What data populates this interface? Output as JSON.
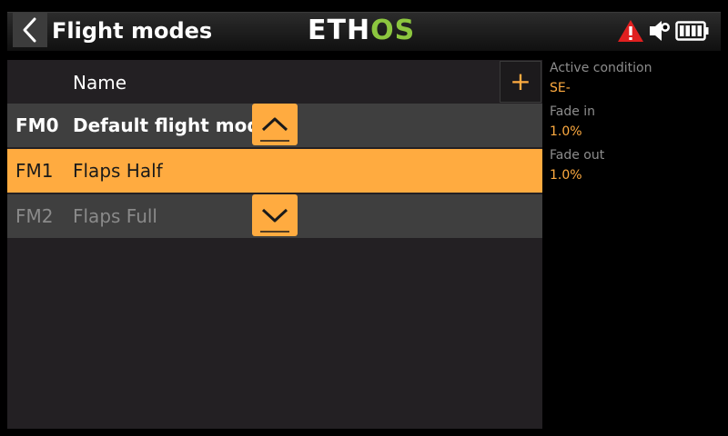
{
  "header": {
    "title": "Flight modes",
    "logo_part1": "ETH",
    "logo_part2": "OS",
    "icons": [
      "warning-icon",
      "volume-icon",
      "battery-icon"
    ],
    "warning_color": "#e02020"
  },
  "list": {
    "column_name": "Name",
    "add_label": "+",
    "rows": [
      {
        "id": "FM0",
        "name": "Default flight mode",
        "state": "default"
      },
      {
        "id": "FM1",
        "name": "Flaps Half",
        "state": "selected"
      },
      {
        "id": "FM2",
        "name": "Flaps Full",
        "state": "inactive"
      }
    ],
    "move_up_icon": "chevron-up-icon",
    "move_down_icon": "chevron-down-icon"
  },
  "details": {
    "active_condition_label": "Active condition",
    "active_condition_value": "SE-",
    "fade_in_label": "Fade in",
    "fade_in_value": "1.0%",
    "fade_out_label": "Fade out",
    "fade_out_value": "1.0%"
  },
  "colors": {
    "accent": "#ffab40",
    "logo_green": "#8cc63f"
  }
}
